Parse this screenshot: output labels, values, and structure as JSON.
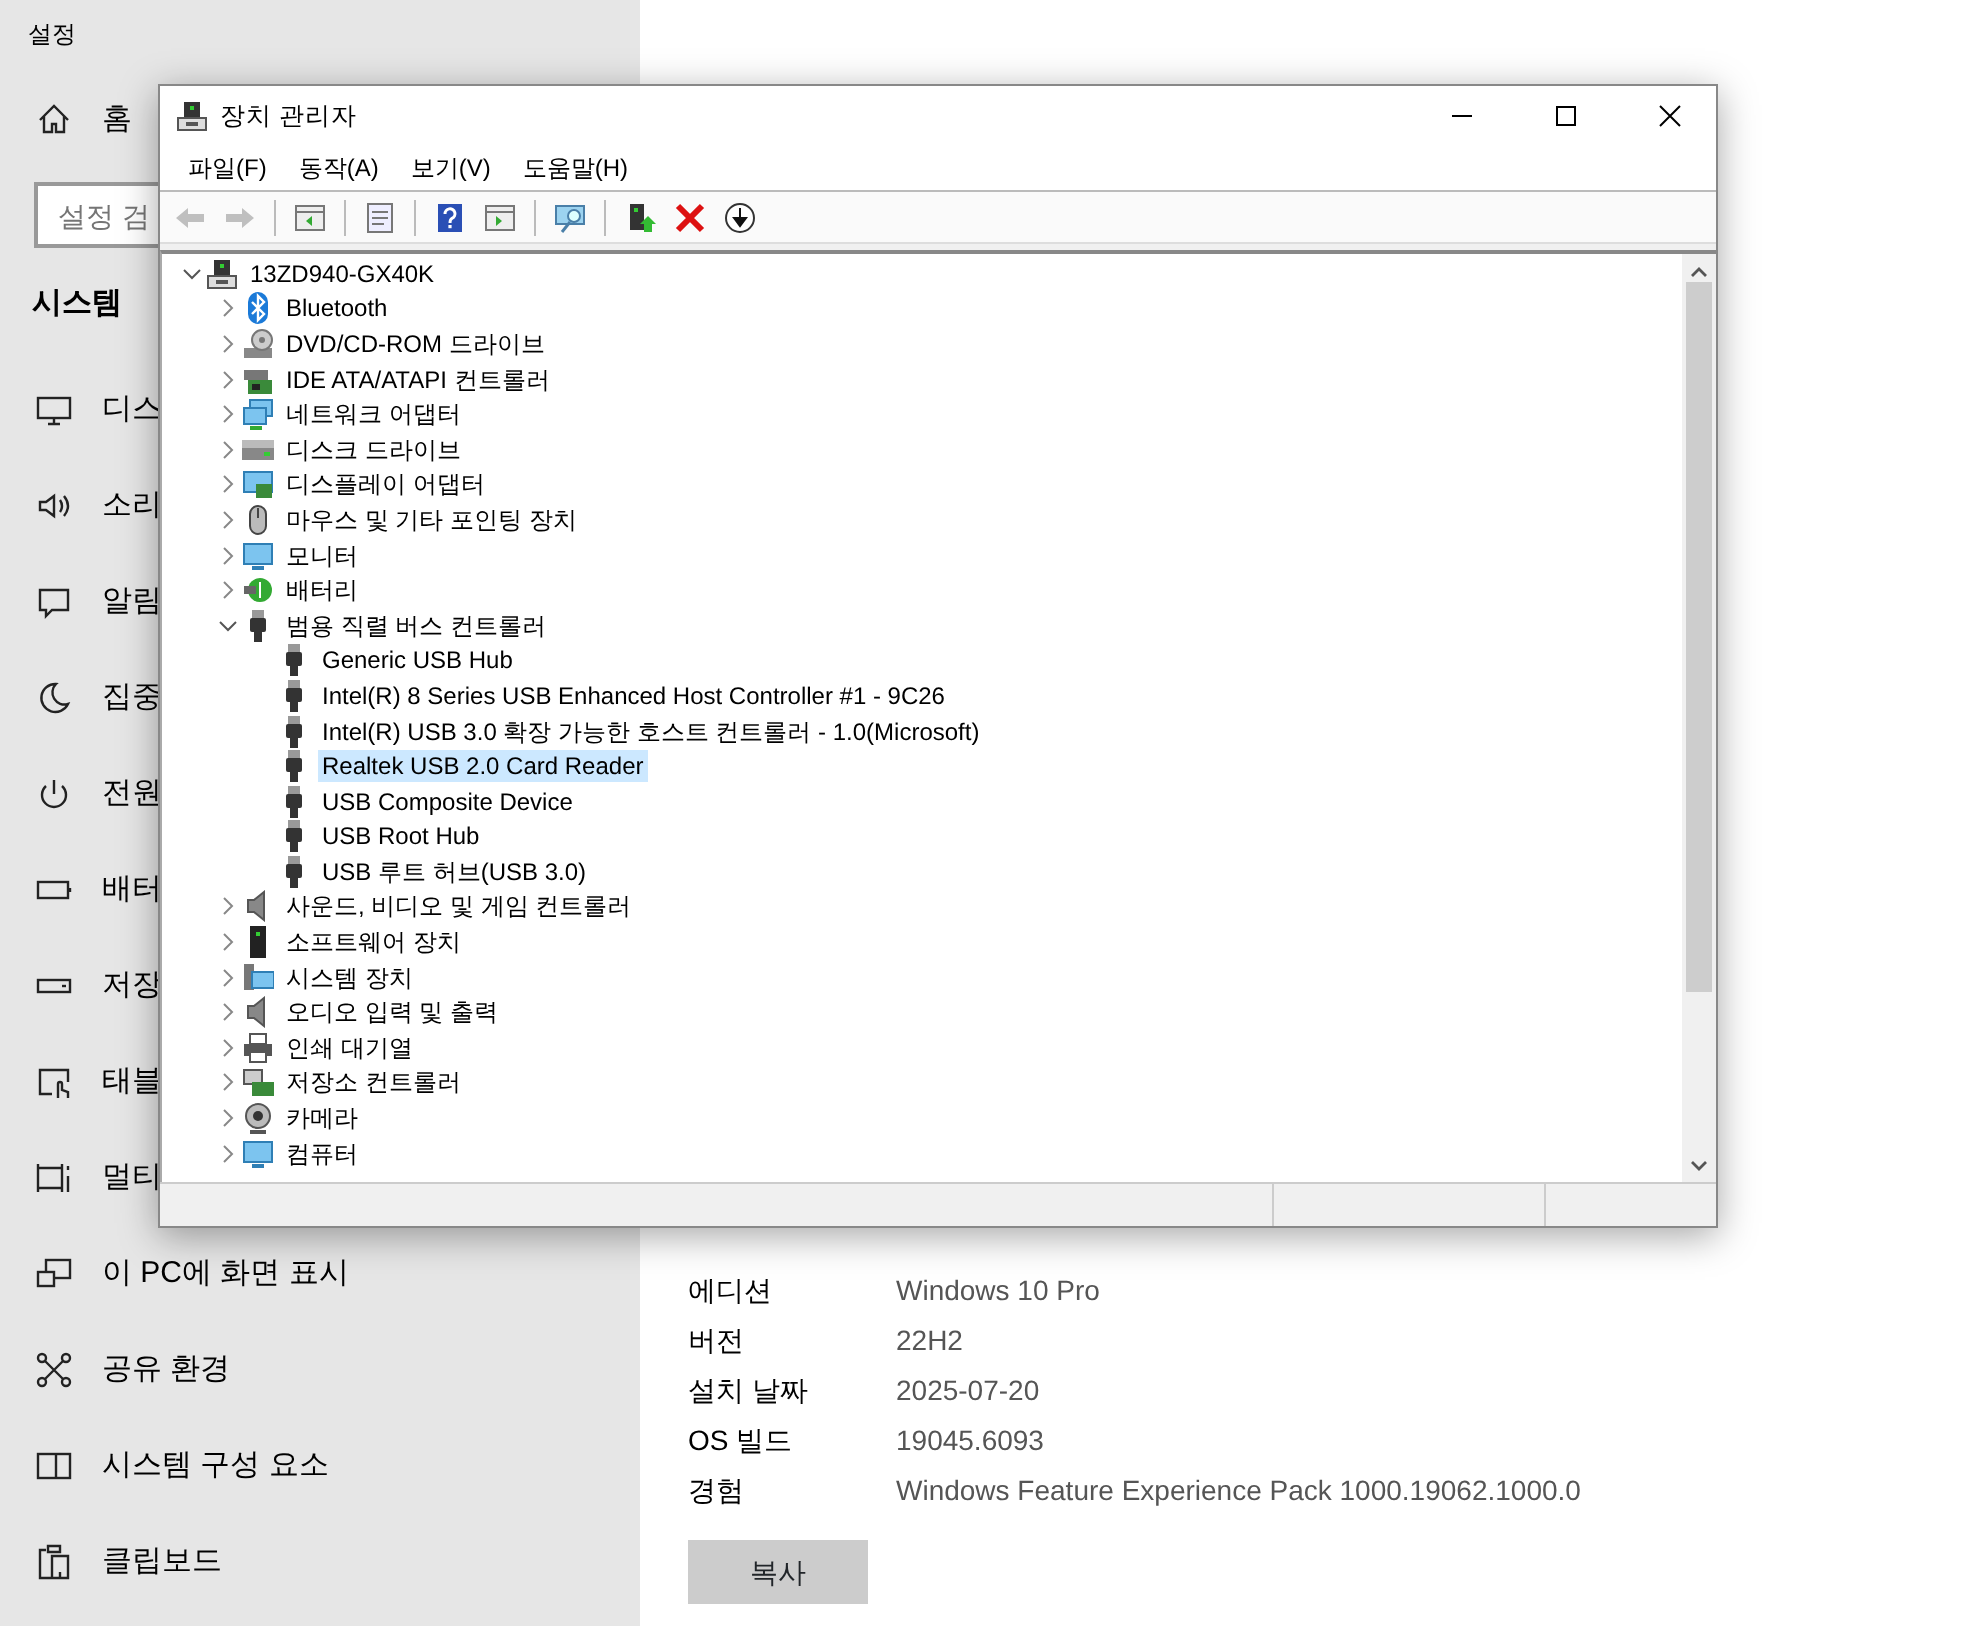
{
  "settings": {
    "title": "설정",
    "home": {
      "label": "홈",
      "kind": "home"
    },
    "search": {
      "placeholder": "설정 검"
    },
    "section": "시스템",
    "nav": [
      {
        "label": "디스",
        "kind": "display"
      },
      {
        "label": "소리",
        "kind": "sound"
      },
      {
        "label": "알림",
        "kind": "notify"
      },
      {
        "label": "집중",
        "kind": "moon"
      },
      {
        "label": "전원",
        "kind": "power"
      },
      {
        "label": "배터",
        "kind": "battery"
      },
      {
        "label": "저장",
        "kind": "storage"
      },
      {
        "label": "태블",
        "kind": "tablet"
      },
      {
        "label": "멀티",
        "kind": "multitask"
      },
      {
        "label": "이 PC에 화면 표시",
        "kind": "project"
      },
      {
        "label": "공유 환경",
        "kind": "share"
      },
      {
        "label": "시스템 구성 요소",
        "kind": "components"
      },
      {
        "label": "클립보드",
        "kind": "clipboard"
      }
    ]
  },
  "about": {
    "rows": [
      {
        "label": "에디션",
        "value": "Windows 10 Pro"
      },
      {
        "label": "버전",
        "value": "22H2"
      },
      {
        "label": "설치 날짜",
        "value": "2025-07-20"
      },
      {
        "label": "OS 빌드",
        "value": "19045.6093"
      },
      {
        "label": "경험",
        "value": "Windows Feature Experience Pack 1000.19062.1000.0"
      }
    ],
    "copy_button": "복사"
  },
  "device_manager": {
    "title": "장치 관리자",
    "menu": [
      "파일(F)",
      "동작(A)",
      "보기(V)",
      "도움말(H)"
    ],
    "toolbar": [
      {
        "kind": "back",
        "disabled": true
      },
      {
        "kind": "forward",
        "disabled": true
      },
      {
        "kind": "sep"
      },
      {
        "kind": "panel",
        "disabled": false
      },
      {
        "kind": "sep"
      },
      {
        "kind": "properties",
        "disabled": false
      },
      {
        "kind": "sep"
      },
      {
        "kind": "help",
        "disabled": false
      },
      {
        "kind": "panel2",
        "disabled": false
      },
      {
        "kind": "sep"
      },
      {
        "kind": "scan",
        "disabled": false
      },
      {
        "kind": "sep"
      },
      {
        "kind": "update",
        "disabled": false
      },
      {
        "kind": "remove",
        "disabled": false
      },
      {
        "kind": "download",
        "disabled": false
      }
    ],
    "tree": [
      {
        "label": "13ZD940-GX40K",
        "kind": "pc",
        "expanded": true,
        "selected": false,
        "children": [
          {
            "label": "Bluetooth",
            "kind": "bluetooth",
            "expanded": false,
            "selected": false
          },
          {
            "label": "DVD/CD-ROM 드라이브",
            "kind": "dvd",
            "expanded": false,
            "selected": false
          },
          {
            "label": "IDE ATA/ATAPI 컨트롤러",
            "kind": "card",
            "expanded": false,
            "selected": false
          },
          {
            "label": "네트워크 어댑터",
            "kind": "network",
            "expanded": false,
            "selected": false
          },
          {
            "label": "디스크 드라이브",
            "kind": "disk",
            "expanded": false,
            "selected": false
          },
          {
            "label": "디스플레이 어댑터",
            "kind": "displaycard",
            "expanded": false,
            "selected": false
          },
          {
            "label": "마우스 및 기타 포인팅 장치",
            "kind": "mouse",
            "expanded": false,
            "selected": false
          },
          {
            "label": "모니터",
            "kind": "monitor",
            "expanded": false,
            "selected": false
          },
          {
            "label": "배터리",
            "kind": "battery",
            "expanded": false,
            "selected": false
          },
          {
            "label": "범용 직렬 버스 컨트롤러",
            "kind": "usb",
            "expanded": true,
            "selected": false,
            "children": [
              {
                "label": "Generic USB Hub",
                "kind": "usb",
                "selected": false
              },
              {
                "label": "Intel(R) 8 Series USB Enhanced Host Controller #1 - 9C26",
                "kind": "usb",
                "selected": false
              },
              {
                "label": "Intel(R) USB 3.0 확장 가능한 호스트 컨트롤러 - 1.0(Microsoft)",
                "kind": "usb",
                "selected": false
              },
              {
                "label": "Realtek USB 2.0 Card Reader",
                "kind": "usb",
                "selected": true
              },
              {
                "label": "USB Composite Device",
                "kind": "usb",
                "selected": false
              },
              {
                "label": "USB Root Hub",
                "kind": "usb",
                "selected": false
              },
              {
                "label": "USB 루트 허브(USB 3.0)",
                "kind": "usb",
                "selected": false
              }
            ]
          },
          {
            "label": "사운드, 비디오 및 게임 컨트롤러",
            "kind": "speaker",
            "expanded": false,
            "selected": false
          },
          {
            "label": "소프트웨어 장치",
            "kind": "software",
            "expanded": false,
            "selected": false
          },
          {
            "label": "시스템 장치",
            "kind": "system",
            "expanded": false,
            "selected": false
          },
          {
            "label": "오디오 입력 및 출력",
            "kind": "speaker",
            "expanded": false,
            "selected": false
          },
          {
            "label": "인쇄 대기열",
            "kind": "printer",
            "expanded": false,
            "selected": false
          },
          {
            "label": "저장소 컨트롤러",
            "kind": "storage",
            "expanded": false,
            "selected": false
          },
          {
            "label": "카메라",
            "kind": "camera",
            "expanded": false,
            "selected": false
          },
          {
            "label": "컴퓨터",
            "kind": "monitor",
            "expanded": false,
            "selected": false
          }
        ]
      }
    ]
  }
}
